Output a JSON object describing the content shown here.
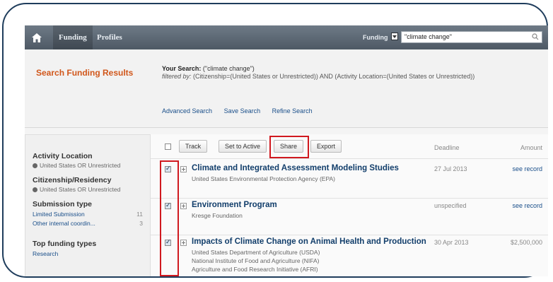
{
  "nav": {
    "tabs": [
      {
        "label": "Funding",
        "active": true
      },
      {
        "label": "Profiles",
        "active": false
      }
    ],
    "search_scope": "Funding",
    "search_value": "\"climate change\""
  },
  "summary": {
    "title": "Search Funding Results",
    "your_search_label": "Your Search:",
    "your_search_query": "(\"climate change\")",
    "filtered_by_label": "filtered by:",
    "filtered_by_text": "(Citizenship=(United States or Unrestricted)) AND (Activity Location=(United States or Unrestricted))",
    "links": [
      "Advanced Search",
      "Save Search",
      "Refine Search"
    ]
  },
  "sidebar": {
    "activity_location": {
      "heading": "Activity Location",
      "value": "United States OR Unrestricted"
    },
    "citizenship": {
      "heading": "Citizenship/Residency",
      "value": "United States OR Unrestricted"
    },
    "submission_type": {
      "heading": "Submission type",
      "items": [
        {
          "label": "Limited Submission",
          "count": "11"
        },
        {
          "label": "Other internal coordin...",
          "count": "3"
        }
      ]
    },
    "top_funding": {
      "heading": "Top funding types",
      "partial": "Research"
    }
  },
  "toolbar": {
    "buttons": [
      "Track",
      "Set to Active",
      "Share",
      "Export"
    ],
    "col_deadline": "Deadline",
    "col_amount": "Amount"
  },
  "results": [
    {
      "title": "Climate and Integrated Assessment Modeling Studies",
      "sponsors": [
        "United States Environmental Protection Agency (EPA)"
      ],
      "deadline": "27 Jul 2013",
      "amount": "see record",
      "checked": true
    },
    {
      "title": "Environment Program",
      "sponsors": [
        "Kresge Foundation"
      ],
      "deadline": "unspecified",
      "amount": "see record",
      "checked": true
    },
    {
      "title": "Impacts of Climate Change on Animal Health and Production",
      "sponsors": [
        "United States Department of Agriculture (USDA)",
        "National Institute of Food and Agriculture (NIFA)",
        "Agriculture and Food Research Initiative (AFRI)"
      ],
      "deadline": "30 Apr 2013",
      "amount": "$2,500,000",
      "checked": true
    }
  ],
  "colors": {
    "nav_bg": "#5b6672",
    "summary_title": "#d1571b",
    "link": "#1a4f8a",
    "result_title": "#123e6b",
    "highlight": "#d0191f",
    "frame": "#1f3d5c"
  },
  "icons": [
    "home-icon",
    "search-icon",
    "checkbox",
    "expand-icon"
  ]
}
